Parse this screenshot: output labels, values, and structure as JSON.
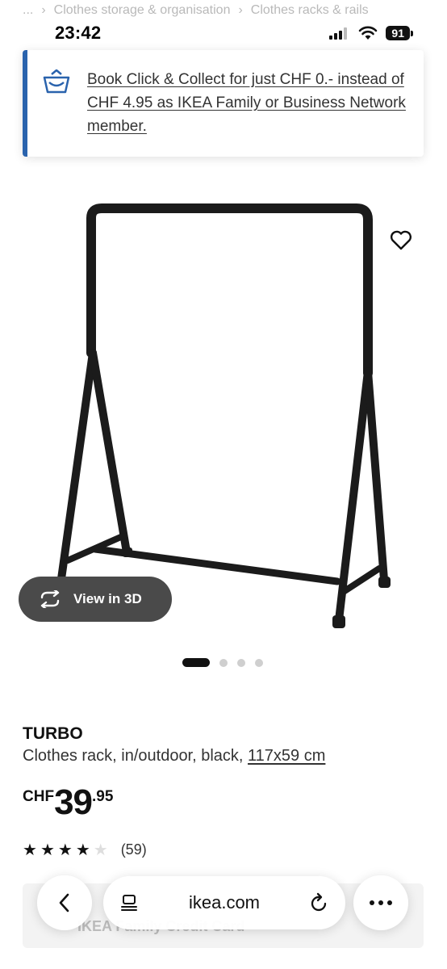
{
  "breadcrumb": {
    "ellipsis": "...",
    "separator": "›",
    "item1": "Clothes storage & organisation",
    "item2": "Clothes racks & rails"
  },
  "status_bar": {
    "time": "23:42",
    "battery": "91"
  },
  "promo": {
    "icon": "basket-icon",
    "text": "Book Click & Collect for just CHF 0.- instead of CHF 4.95 as IKEA Family or Business Network member.",
    "accent_color": "#2a63ad"
  },
  "product": {
    "image_icon": "clothes-rack-image",
    "favourite_icon": "heart-icon",
    "view3d_label": "View in 3D",
    "carousel": {
      "total": 4,
      "active": 1
    },
    "name": "TURBO",
    "description": "Clothes rack, in/outdoor, black, ",
    "dimensions": "117x59 cm",
    "price": {
      "currency": "CHF",
      "integer": "39",
      "decimal": ".95"
    },
    "rating": {
      "value": 4,
      "max": 5,
      "count": "(59)"
    },
    "hidden_offer_text": "IKEA Family Credit Card"
  },
  "browser": {
    "url": "ikea.com",
    "back_icon": "chevron-left-icon",
    "reader_icon": "page-layout-icon",
    "reload_icon": "reload-icon",
    "more_icon": "more-icon"
  }
}
